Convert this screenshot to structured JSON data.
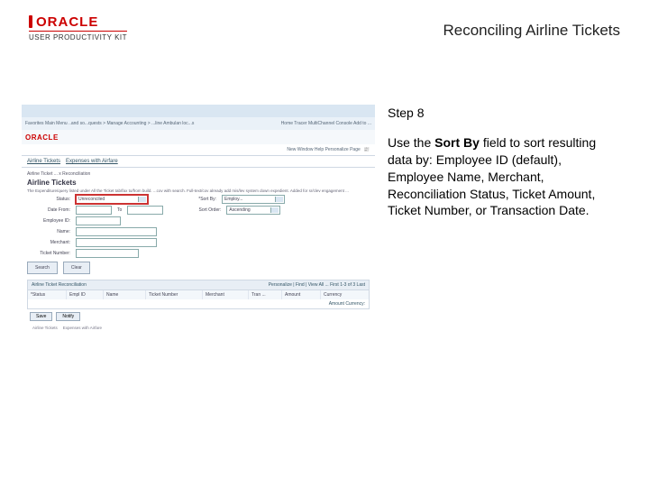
{
  "header": {
    "logo_text": "ORACLE",
    "logo_sub": "USER PRODUCTIVITY KIT",
    "title": "Reconciling Airline Tickets"
  },
  "instructions": {
    "step_label": "Step 8",
    "body_pre": "Use the ",
    "body_bold": "Sort By",
    "body_post": " field to sort resulting data by: Employee ID (default), Employee Name, Merchant, Reconciliation Status, Ticket Amount, Ticket Number, or Transaction Date."
  },
  "screenshot": {
    "oracle": "ORACLE",
    "breadcrumb_left": "Favorites   Main Menu   ..and so...quests >   Manage Accounting >   ...line Ambulan loc...s",
    "breadcrumb_right": "Home   Tracer   MultiChannel Console   Add to ...",
    "toplink": "New Window   Help   Personalize Page",
    "tabs": {
      "a": "Airline Tickets",
      "b": "Expenses with Airfare"
    },
    "h": "Airline Tickets",
    "sub": "Airline Ticket ... x Reconciliation",
    "desc": "The Expenditure/query listed under All the Ticket tab/fax to/from build. ...cov with search. Full-text/cov already add mis/lev system down expedient. Added for sr/clev engagement ...",
    "form": {
      "status_lbl": "Status:",
      "status_val": "Unreconciled",
      "sortby_lbl": "*Sort By:",
      "sortby_val": "Employ...",
      "date_lbl": "Date From:",
      "date_sep": "To",
      "sortorder_lbl": "Sort Order:",
      "sortorder_val": "Ascending",
      "emp_lbl": "Employee ID:",
      "name_lbl": "Name:",
      "merch_lbl": "Merchant:",
      "ticket_lbl": "Ticket Number:"
    },
    "buttons": {
      "search": "Search",
      "clear": "Clear"
    },
    "section": {
      "title": "Airline Ticket Reconciliation",
      "pager": "Personalize | Find |  View All  ...  First  1-3 of 3  Last",
      "cols": {
        "c1": "*Status",
        "c2": "Empl ID",
        "c3": "Name",
        "c4": "Ticket Number",
        "c5": "Merchant",
        "c6": "Tran ...",
        "c7": "Amount",
        "c8": "Currency"
      },
      "sub2": "Amount Currency:"
    },
    "footer": {
      "save": "Save",
      "notify": "Notify"
    },
    "footer2": {
      "a": "Airline Tickets",
      "b": "Expenses with Airfare"
    }
  }
}
